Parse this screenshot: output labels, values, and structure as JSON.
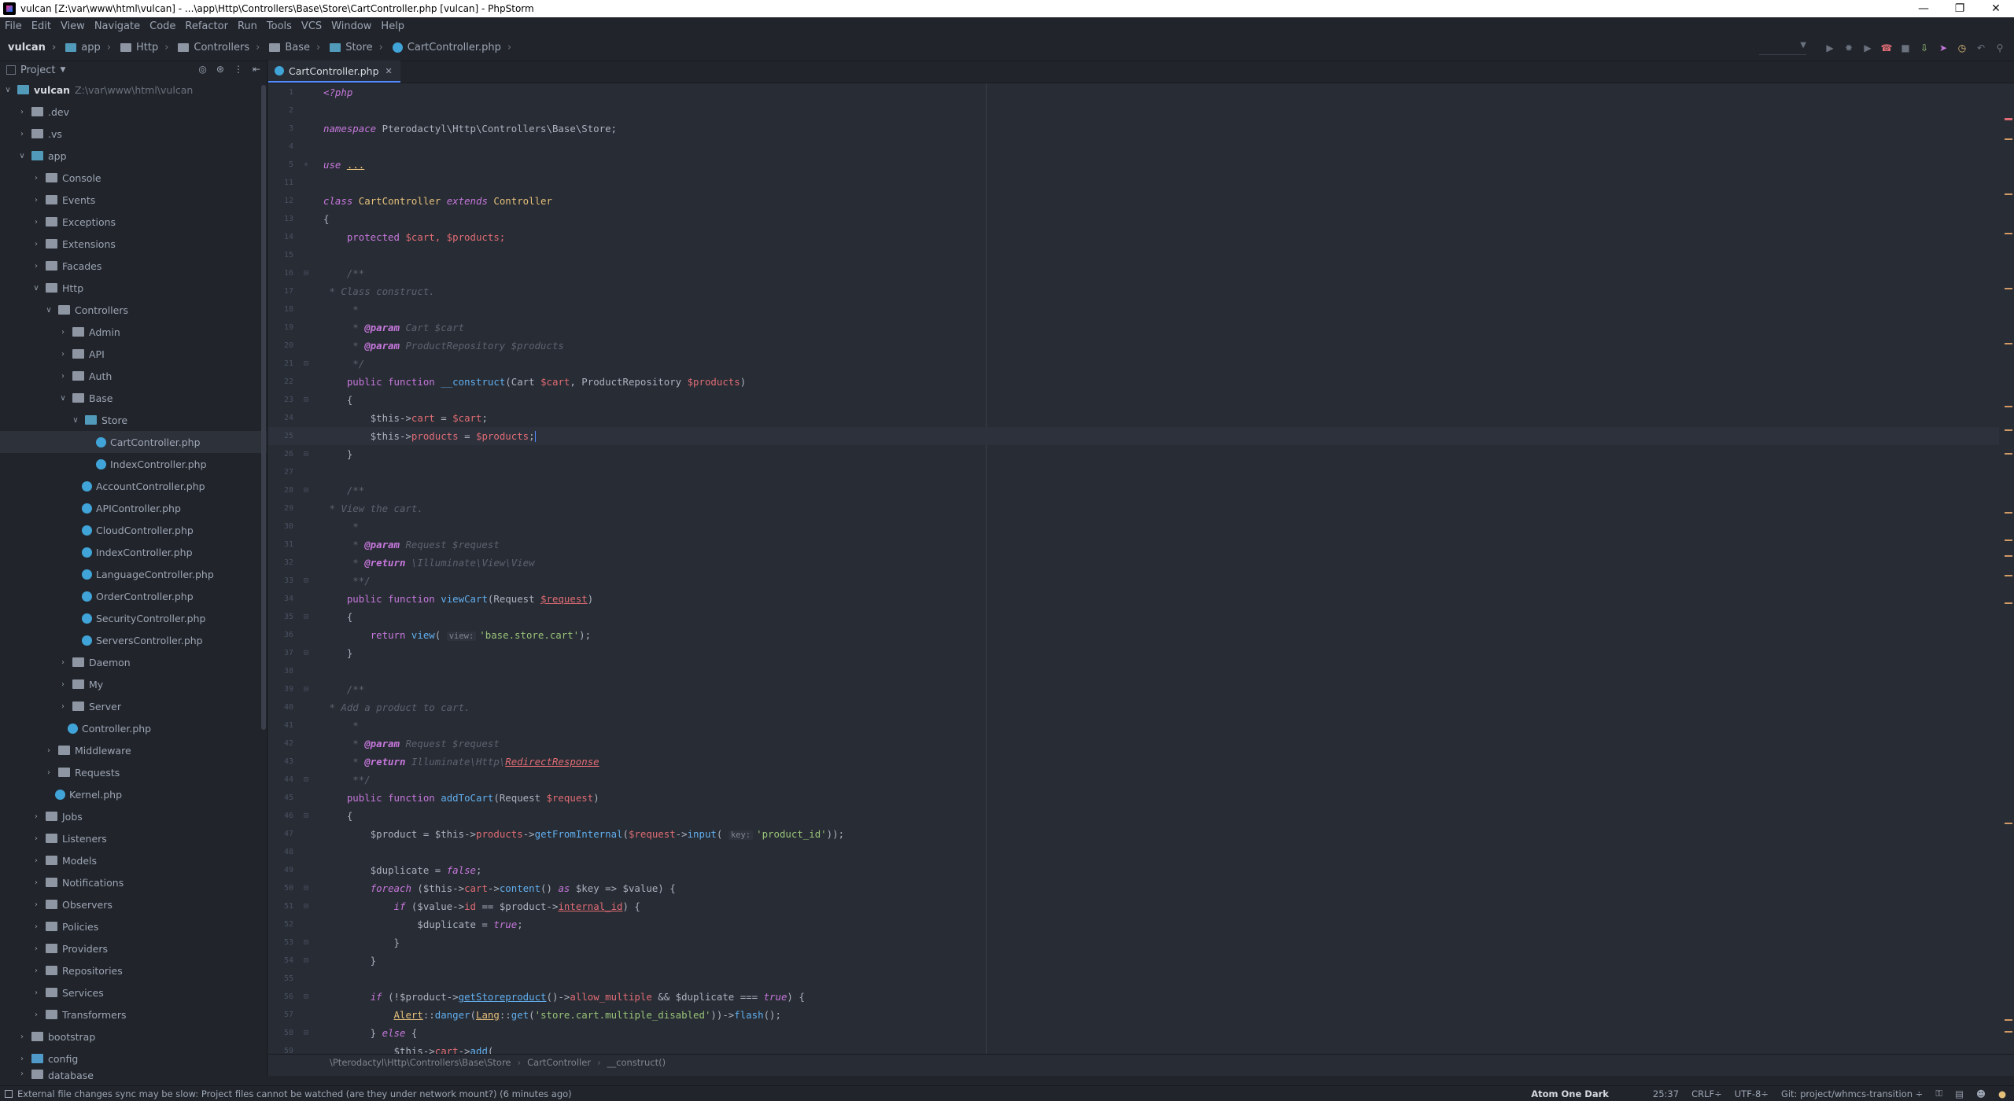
{
  "window": {
    "title": "vulcan [Z:\\var\\www\\html\\vulcan] - ...\\app\\Http\\Controllers\\Base\\Store\\CartController.php [vulcan] - PhpStorm"
  },
  "menu": [
    "File",
    "Edit",
    "View",
    "Navigate",
    "Code",
    "Refactor",
    "Run",
    "Tools",
    "VCS",
    "Window",
    "Help"
  ],
  "breadcrumbs": [
    "vulcan",
    "app",
    "Http",
    "Controllers",
    "Base",
    "Store",
    "CartController.php"
  ],
  "project_panel": {
    "title": "Project",
    "root_name": "vulcan",
    "root_path": "Z:\\var\\www\\html\\vulcan",
    "items": [
      ".dev",
      ".vs",
      "app",
      "Console",
      "Events",
      "Exceptions",
      "Extensions",
      "Facades",
      "Http",
      "Controllers",
      "Admin",
      "API",
      "Auth",
      "Base",
      "Store",
      "CartController.php",
      "IndexController.php",
      "AccountController.php",
      "APIController.php",
      "CloudController.php",
      "IndexController.php",
      "LanguageController.php",
      "OrderController.php",
      "SecurityController.php",
      "ServersController.php",
      "Daemon",
      "My",
      "Server",
      "Controller.php",
      "Middleware",
      "Requests",
      "Kernel.php",
      "Jobs",
      "Listeners",
      "Models",
      "Notifications",
      "Observers",
      "Policies",
      "Providers",
      "Repositories",
      "Services",
      "Transformers",
      "bootstrap",
      "config",
      "database"
    ]
  },
  "editor": {
    "tab_label": "CartController.php",
    "breadcrumb": [
      "\\Pterodactyl\\Http\\Controllers\\Base\\Store",
      "CartController",
      "__construct()"
    ]
  },
  "statusbar": {
    "message": "External file changes sync may be slow: Project files cannot be watched (are they under network mount?) (6 minutes ago)",
    "theme": "Atom One Dark",
    "position": "25:37",
    "line_sep": "CRLF÷",
    "encoding": "UTF-8÷",
    "git": "Git: project/whmcs-transition ÷"
  },
  "code": {
    "l1": "<?php",
    "ns_kw": "namespace",
    "ns_val": "Pterodactyl\\Http\\Controllers\\Base\\Store;",
    "use_kw": "use",
    "use_dots": "...",
    "class_kw": "class",
    "class_name": "CartController",
    "extends_kw": "extends",
    "parent": "Controller",
    "protected_kw": "protected",
    "props": "$cart, $products;",
    "c_class_construct": " * Class construct.",
    "c_param": "@param",
    "c_cart": " Cart $cart",
    "c_repo": " ProductRepository $products",
    "c_view_cart": " * View the cart.",
    "c_request": " Request $request",
    "c_return": "@return",
    "c_view": " \\Illuminate\\View\\View",
    "c_add": " * Add a product to cart.",
    "c_redirect_ns": " Illuminate\\Http\\",
    "c_redirect": "RedirectResponse",
    "public_kw": "public",
    "function_kw": "function",
    "construct_fn": "__construct",
    "construct_args_a": "(Cart ",
    "construct_args_b": "$cart",
    "construct_args_c": ", ProductRepository ",
    "construct_args_d": "$products",
    "this": "$this",
    "cart_prop": "cart",
    "cart_val": "$cart",
    "products_prop": "products",
    "products_val": "$products",
    "view_cart_fn": "viewCart",
    "request_type": "(Request ",
    "request_var": "$request",
    "return_kw": "return",
    "view_fn": "view",
    "hint_view": "view:",
    "view_str": "'base.store.cart'",
    "add_fn": "addToCart",
    "product_var": "$product",
    "get_internal": "getFromInternal",
    "input_fn": "input",
    "hint_key": "key:",
    "product_id_str": "'product_id'",
    "duplicate_var": "$duplicate",
    "false_kw": "false",
    "true_kw": "true",
    "foreach_kw": "foreach",
    "content_fn": "content",
    "as_kw": "as",
    "key_var": "$key",
    "value_var": "$value",
    "if_kw": "if",
    "id_prop": "id",
    "internal_id": "internal_id",
    "get_store_product": "getStoreproduct",
    "allow_multiple": "allow_multiple",
    "alert_cls": "Alert",
    "danger_fn": "danger",
    "lang_cls": "Lang",
    "get_fn": "get",
    "multiple_disabled_str": "'store.cart.multiple_disabled'",
    "flash_fn": "flash",
    "else_kw": "else",
    "add_call": "add"
  }
}
